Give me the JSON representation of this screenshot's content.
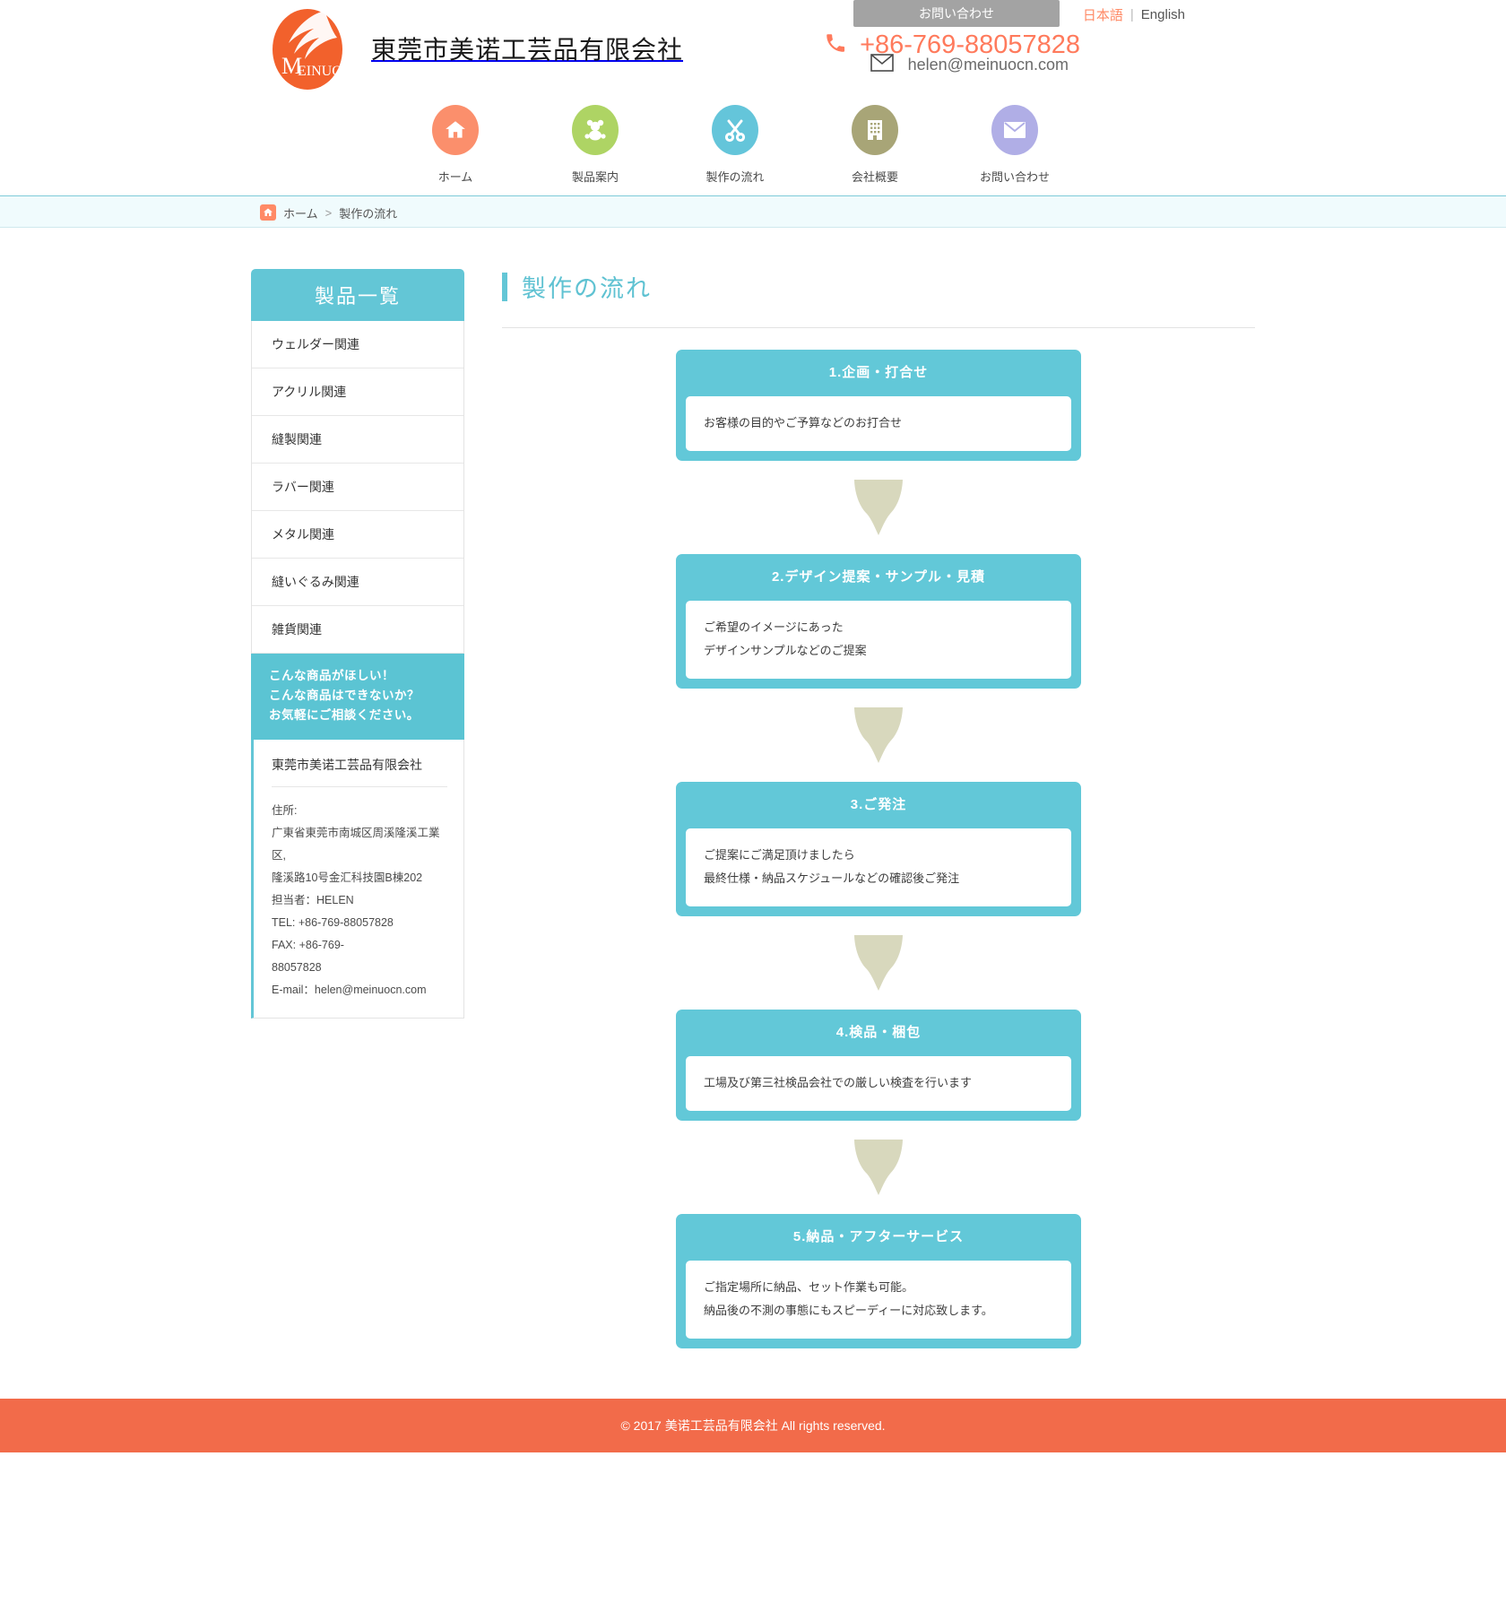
{
  "header": {
    "logo_text": "MEINUO",
    "company_name": "東莞市美诺工芸品有限会社",
    "contact_button": "お問い合わせ",
    "lang_ja": "日本語",
    "lang_sep": "|",
    "lang_en": "English",
    "phone": "+86-769-88057828",
    "email": "helen@meinuocn.com",
    "phone_icon": "phone-icon",
    "mail_icon": "envelope-icon"
  },
  "nav": {
    "items": [
      {
        "label": "ホーム",
        "icon": "home-icon",
        "color": "#fb8f6c"
      },
      {
        "label": "製品案内",
        "icon": "teddy-bear-icon",
        "color": "#aed464"
      },
      {
        "label": "製作の流れ",
        "icon": "scissors-icon",
        "color": "#64c5da"
      },
      {
        "label": "会社概要",
        "icon": "building-icon",
        "color": "#a8a577"
      },
      {
        "label": "お問い合わせ",
        "icon": "envelope-icon",
        "color": "#b0aee6"
      }
    ]
  },
  "breadcrumb": {
    "home_icon": "home-icon",
    "home": "ホーム",
    "separator": ">",
    "current": "製作の流れ"
  },
  "sidebar": {
    "heading": "製品一覧",
    "items": [
      {
        "label": "ウェルダー関連"
      },
      {
        "label": "アクリル関連"
      },
      {
        "label": "縫製関連"
      },
      {
        "label": "ラバー関連"
      },
      {
        "label": "メタル関連"
      },
      {
        "label": "縫いぐるみ関連"
      },
      {
        "label": "雑貨関連"
      }
    ],
    "cta_lines": [
      "こんな商品がほしい！",
      "こんな商品はできないか？",
      "お気軽にご相談ください。"
    ],
    "info": {
      "title": "東莞市美诺工芸品有限会社",
      "lines": [
        "住所:",
        "广東省東莞市南城区周溪隆溪工業区,",
        "隆溪路10号金汇科技園B棟202",
        "担当者：HELEN",
        "TEL:  +86-769-88057828",
        "FAX: +86-769-",
        "88057828",
        "E-mail：helen@meinuocn.com"
      ]
    }
  },
  "main": {
    "page_title": "製作の流れ",
    "steps": [
      {
        "title": "1.企画・打合せ",
        "body": [
          "お客様の目的やご予算などのお打合せ"
        ]
      },
      {
        "title": "2.デザイン提案・サンプル・見積",
        "body": [
          "ご希望のイメージにあった",
          "デザインサンプルなどのご提案"
        ]
      },
      {
        "title": "3.ご発注",
        "body": [
          "ご提案にご満足頂けましたら",
          "最終仕様・納品スケジュールなどの確認後ご発注"
        ]
      },
      {
        "title": "4.検品・梱包",
        "body": [
          "工場及び第三社検品会社での厳しい検査を行います"
        ]
      },
      {
        "title": "5.納品・アフターサービス",
        "body": [
          "ご指定場所に納品、セット作業も可能。",
          "納品後の不測の事態にもスピーディーに対応致します。"
        ]
      }
    ]
  },
  "footer": {
    "text": "© 2017 美诺工芸品有限会社 All rights reserved."
  },
  "colors": {
    "accent_teal": "#63c6d6",
    "accent_orange": "#ff7a5c",
    "footer_orange": "#f26b4a",
    "arrow_khaki": "#d8d8bd"
  }
}
